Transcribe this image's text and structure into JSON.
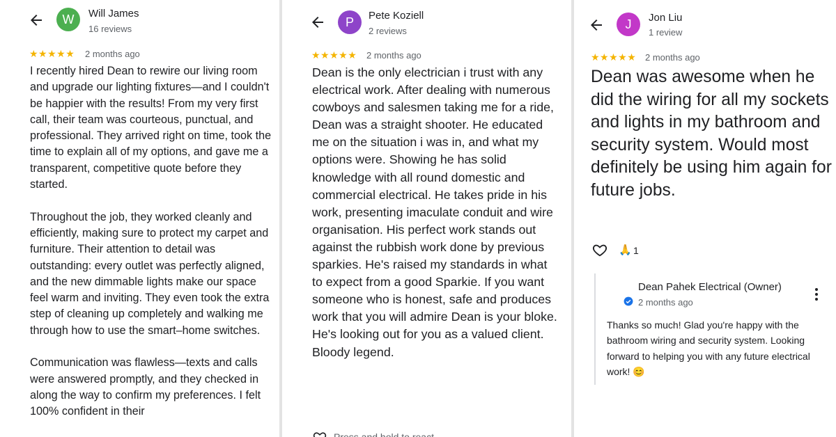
{
  "reviews": [
    {
      "author": "Will James",
      "author_reviews": "16 reviews",
      "avatar_letter": "W",
      "avatar_color": "#4caf50",
      "rating": 5,
      "stars": "★★★★★",
      "date": "2 months ago",
      "text": "I recently hired Dean to rewire our living room and upgrade our lighting fixtures—and I couldn't be happier with the results! From my very first call, their team was courteous, punctual, and professional. They arrived right on time, took the time to explain all of my options, and gave me a transparent, competitive quote before they started.\n\nThroughout the job, they worked cleanly and efficiently, making sure to protect my carpet and furniture. Their attention to detail was outstanding: every outlet was perfectly aligned, and the new dimmable lights make our space feel warm and inviting. They even took the extra step of cleaning up completely and walking me through how to use the smart–home switches.\n\nCommunication was flawless—texts and calls were answered promptly, and they checked in along the way to confirm my preferences. I felt 100% confident in their"
    },
    {
      "author": "Pete Koziell",
      "author_reviews": "2 reviews",
      "avatar_letter": "P",
      "avatar_color": "#8e44c9",
      "rating": 5,
      "stars": "★★★★★",
      "date": "2 months ago",
      "text": "Dean is the only electrician i trust with any electrical work. After dealing with numerous cowboys and salesmen taking me for a ride, Dean was a straight shooter. He educated me on the situation i was in, and what my options were. Showing he has solid knowledge with all round domestic and commercial electrical. He takes pride in his work, presenting imaculate conduit and wire organisation. His perfect work stands out against the rubbish work done by previous sparkies. He's raised my standards in what to expect from a good Sparkie. If you want someone who is honest, safe and produces work that you will admire Dean is your bloke. He's looking out for you as a valued client. Bloody legend.",
      "hint": "Press and hold to react"
    },
    {
      "author": "Jon Liu",
      "author_reviews": "1 review",
      "avatar_letter": "J",
      "avatar_color": "#c238c8",
      "rating": 5,
      "stars": "★★★★★",
      "date": "2 months ago",
      "text": "Dean was awesome when he did the wiring for all my sockets and lights in my bathroom and security system. Would most definitely be using him again for future jobs.",
      "reaction_emoji": "🙏",
      "reaction_count": "1",
      "owner_reply": {
        "name": "Dean Pahek Electrical (Owner)",
        "date": "2 months ago",
        "text": "Thanks so much! Glad you're happy with the bathroom wiring and security system. Looking forward to helping you with any future electrical work! 😊"
      }
    }
  ],
  "icons": {
    "back": "arrow-left-icon",
    "like": "heart-outline-icon",
    "verified": "verified-badge-icon",
    "more": "more-vert-icon"
  },
  "colors": {
    "star": "#f4b400",
    "verified": "#1a73e8",
    "secondary_text": "#5f6368"
  }
}
